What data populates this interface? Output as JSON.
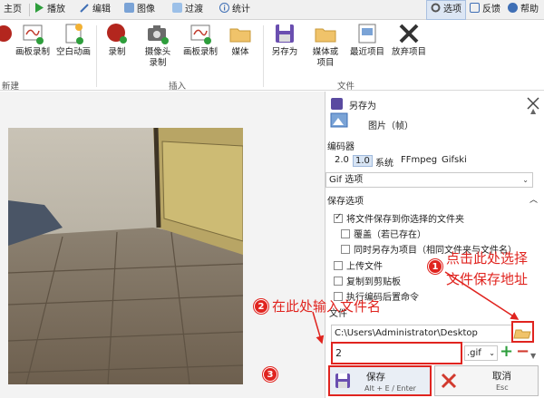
{
  "menu": {
    "items": [
      "主页",
      "播放",
      "编辑",
      "图像",
      "过渡",
      "统计"
    ],
    "right_items": [
      "选项",
      "反馈",
      "帮助"
    ]
  },
  "ribbon": {
    "left_buttons": [
      "录制",
      "画板录制",
      "空白动画"
    ],
    "left_group": "新建",
    "insert_buttons": [
      {
        "label": "录制",
        "label2": ""
      },
      {
        "label": "摄像头",
        "label2": "录制"
      },
      {
        "label": "画板录制",
        "label2": ""
      },
      {
        "label": "媒体",
        "label2": ""
      }
    ],
    "insert_group": "插入",
    "file_buttons": [
      {
        "label": "另存为",
        "label2": ""
      },
      {
        "label": "媒体或",
        "label2": "项目"
      },
      {
        "label": "最近项目",
        "label2": ""
      },
      {
        "label": "放弃项目",
        "label2": ""
      }
    ],
    "file_group": "文件"
  },
  "panel": {
    "title": "另存为",
    "type_label": "图片（帧）",
    "encoder_label": "编码器",
    "encoder_tabs": [
      "2.0",
      "1.0",
      "系统",
      "FFmpeg",
      "Gifski"
    ],
    "encoder_selected": "1.0",
    "gif_options": "Gif 选项",
    "save_options": "保存选项",
    "checks": [
      {
        "label": "将文件保存到你选择的文件夹",
        "checked": true
      },
      {
        "label": "覆盖（若已存在）",
        "checked": false
      },
      {
        "label": "同时另存为项目（相同文件夹与文件名）",
        "checked": false
      },
      {
        "label": "上传文件",
        "checked": false
      },
      {
        "label": "复制到剪贴板",
        "checked": false
      },
      {
        "label": "执行编码后置命令",
        "checked": false
      }
    ],
    "file_label": "文件",
    "path": "C:\\Users\\Administrator\\Desktop",
    "filename": "2",
    "extension": ".gif",
    "save_button": "保存",
    "save_shortcut": "Alt + E / Enter",
    "cancel_button": "取消",
    "cancel_shortcut": "Esc"
  },
  "annotations": {
    "n1": "1",
    "n1_text_a": "点击此处选择",
    "n1_text_b": "文件保存地址",
    "n2": "2",
    "n2_text": "在此处输入文件名",
    "n3": "3"
  },
  "colors": {
    "accent_red": "#e0241f",
    "tab_selected": "#d7e4f4"
  }
}
